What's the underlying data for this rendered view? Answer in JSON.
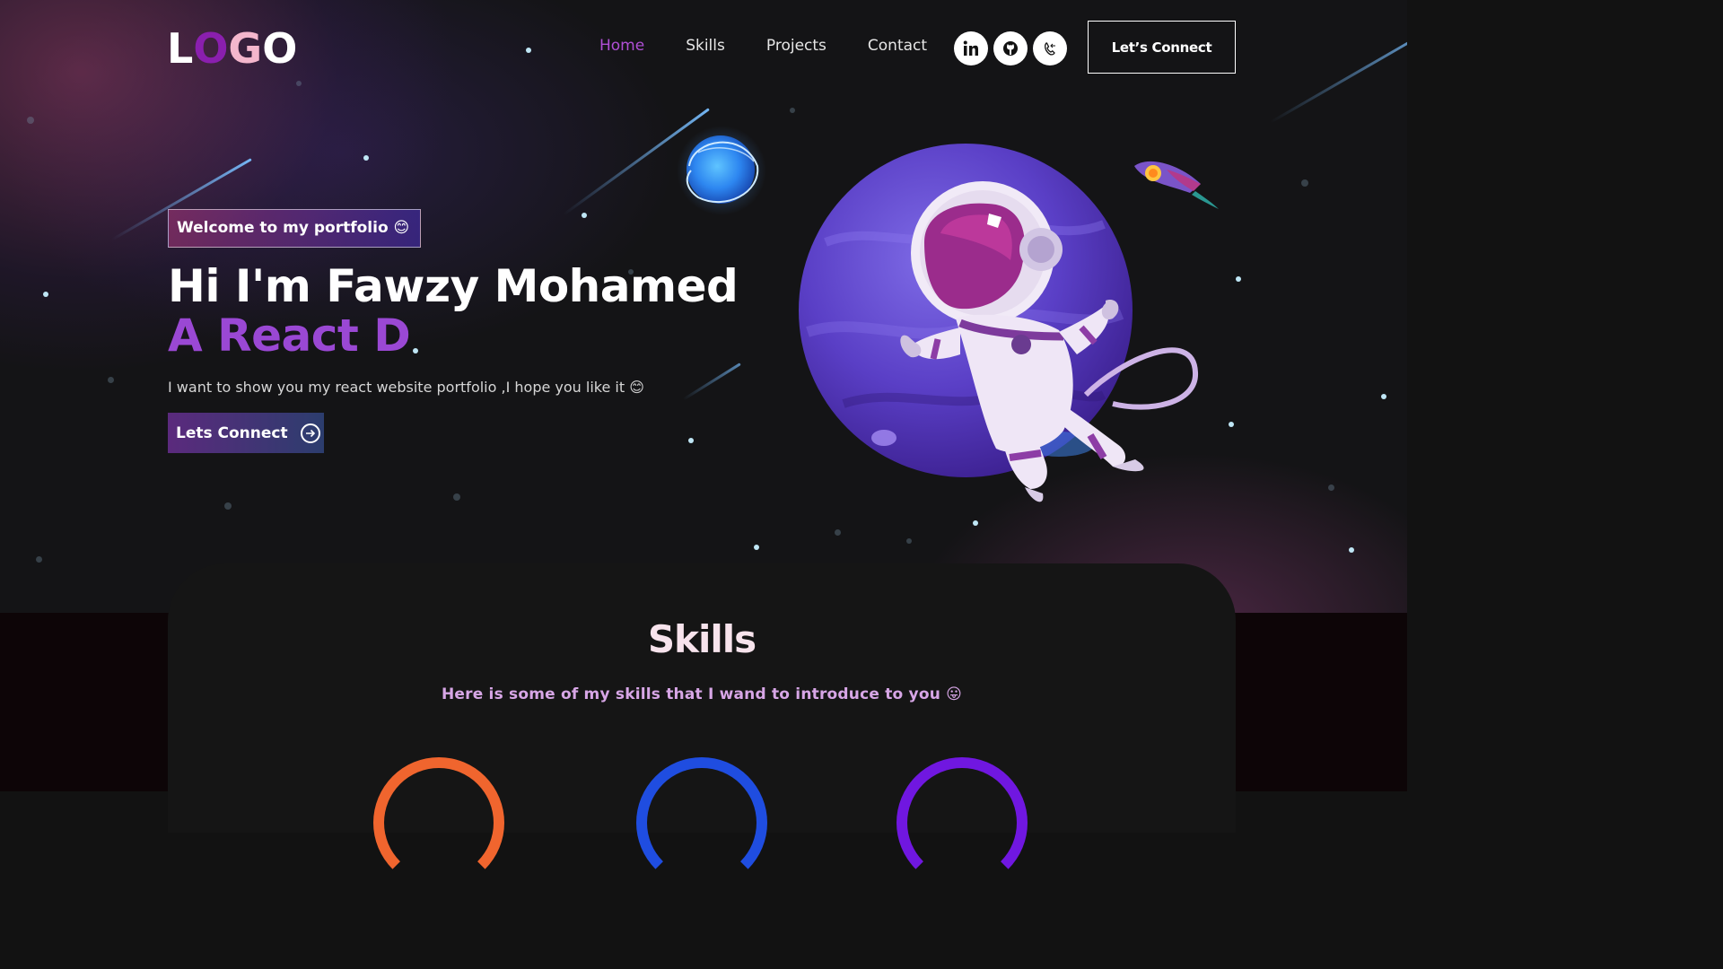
{
  "header": {
    "logo_letters": [
      "L",
      "O",
      "G",
      "O"
    ],
    "logo_colors": [
      "#ffffff",
      "#8a1fae",
      "#f4b6cc",
      "#ffffff"
    ],
    "nav": [
      {
        "label": "Home",
        "active": true
      },
      {
        "label": "Skills",
        "active": false
      },
      {
        "label": "Projects",
        "active": false
      },
      {
        "label": "Contact",
        "active": false
      }
    ],
    "social_icons": [
      "linkedin-icon",
      "github-icon",
      "phone-icon"
    ],
    "connect_label": "Let’s Connect"
  },
  "hero": {
    "tagline": "Welcome to my portfolio 😊",
    "headline": "Hi I'm Fawzy Mohamed",
    "typed_text": "A React D",
    "intro": "I want to show you my react website portfolio ,I hope you like it 😊",
    "cta_label": "Lets Connect",
    "accent_color": "#9a48d4"
  },
  "skills": {
    "title": "Skills",
    "subtitle": "Here is some of my skills that I wand to introduce to you 😛",
    "ring_colors": [
      "#f0652e",
      "#1f4de0",
      "#7017e0"
    ]
  }
}
